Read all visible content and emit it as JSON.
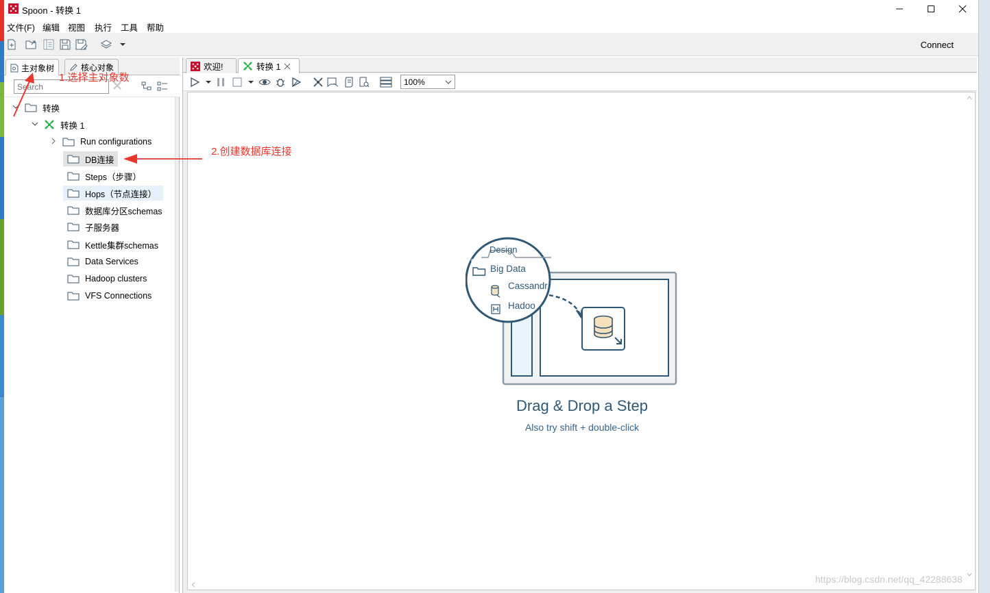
{
  "window": {
    "title": "Spoon - 转换 1",
    "controls": [
      "minimize",
      "maximize",
      "close"
    ]
  },
  "menu": {
    "items": [
      "文件(F)",
      "编辑",
      "视图",
      "执行",
      "工具",
      "帮助"
    ]
  },
  "toolbar": {
    "icons": [
      "new-file-icon",
      "open-file-icon",
      "explore-icon",
      "save-icon",
      "save-as-icon",
      "layers-icon",
      "dropdown-icon"
    ],
    "connect_label": "Connect"
  },
  "left_panel": {
    "tabs": [
      {
        "label": "主对象树",
        "icon": "tree-icon",
        "active": true
      },
      {
        "label": "核心对象",
        "icon": "pencil-icon",
        "active": false
      }
    ],
    "search": {
      "value": "",
      "placeholder": "Search"
    },
    "tree": [
      {
        "label": "转换",
        "level": 0,
        "expanded": true,
        "icon": "folder-icon"
      },
      {
        "label": "转换 1",
        "level": 1,
        "expanded": true,
        "icon": "transformation-icon"
      },
      {
        "label": "Run configurations",
        "level": 2,
        "expanded": false,
        "icon": "folder-icon"
      },
      {
        "label": "DB连接",
        "level": 2,
        "icon": "folder-icon",
        "selected": true
      },
      {
        "label": "Steps（步骤）",
        "level": 2,
        "icon": "folder-icon"
      },
      {
        "label": "Hops（节点连接）",
        "level": 2,
        "icon": "folder-icon",
        "hover": true
      },
      {
        "label": "数据库分区schemas",
        "level": 2,
        "icon": "folder-icon"
      },
      {
        "label": "子服务器",
        "level": 2,
        "icon": "folder-icon"
      },
      {
        "label": "Kettle集群schemas",
        "level": 2,
        "icon": "folder-icon"
      },
      {
        "label": "Data Services",
        "level": 2,
        "icon": "folder-icon"
      },
      {
        "label": "Hadoop clusters",
        "level": 2,
        "icon": "folder-icon"
      },
      {
        "label": "VFS Connections",
        "level": 2,
        "icon": "folder-icon"
      }
    ]
  },
  "editor": {
    "tabs": [
      {
        "label": "欢迎!",
        "icon": "spoon-icon",
        "active": false
      },
      {
        "label": "转换 1",
        "icon": "transformation-icon",
        "active": true,
        "closable": true
      }
    ],
    "zoom": "100%",
    "canvas_icons": [
      "run-icon",
      "run-dropdown-icon",
      "pause-icon",
      "stop-icon",
      "stop-dropdown-icon",
      "preview-icon",
      "debug-icon",
      "replay-icon",
      "verify-icon",
      "impact-icon",
      "sql-icon",
      "explore-db-icon",
      "results-icon"
    ],
    "empty_state": {
      "illustration": {
        "tab_label": "Design",
        "folder_label": "Big Data",
        "item1": "Cassandr",
        "item2": "Hadoo"
      },
      "title": "Drag & Drop a Step",
      "subtitle": "Also try shift + double-click"
    }
  },
  "annotations": {
    "step1": "1.选择主对象数",
    "step2": "2.创建数据库连接",
    "color": "#e8362d"
  },
  "watermark": "https://blog.csdn.net/qq_42288638",
  "colors": {
    "accent_red": "#e8362d",
    "design_blue": "#2f5876",
    "selection": "#e3e3e3"
  }
}
